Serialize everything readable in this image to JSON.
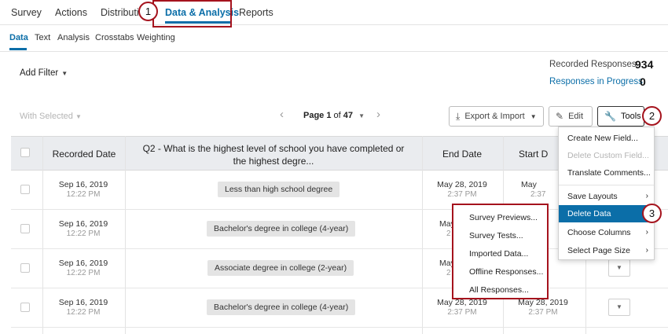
{
  "top_nav": {
    "tabs": [
      {
        "label": "Survey"
      },
      {
        "label": "Actions"
      },
      {
        "label": "Distributio"
      },
      {
        "label": "Data & Analysis"
      },
      {
        "label": "Reports"
      }
    ],
    "active": "Data & Analysis"
  },
  "sub_nav": {
    "tabs": [
      {
        "label": "Data"
      },
      {
        "label": "Text"
      },
      {
        "label": "Analysis"
      },
      {
        "label": "Crosstabs"
      },
      {
        "label": "Weighting"
      }
    ],
    "active": "Data"
  },
  "filter": {
    "label": "Add Filter"
  },
  "stats": {
    "recorded_label": "Recorded Responses",
    "recorded_value": "934",
    "in_progress_label": "Responses in Progress",
    "in_progress_value": "0"
  },
  "toolbar": {
    "with_selected": "With Selected",
    "page_label": "Page",
    "page_current": "1",
    "page_of": "of",
    "page_total": "47",
    "export_label": "Export & Import",
    "edit_label": "Edit",
    "tools_label": "Tools"
  },
  "table": {
    "headers": {
      "recorded_date": "Recorded Date",
      "q2": "Q2 - What is the highest level of school you have completed or the highest degre...",
      "end_date": "End Date",
      "start_date": "Start D"
    },
    "rows": [
      {
        "recorded_date": "Sep 16, 2019",
        "recorded_time": "12:22 PM",
        "answer": "Less than high school degree",
        "end_date": "May 28, 2019",
        "end_time": "2:37 PM",
        "start_date": "May",
        "start_time": "2:37"
      },
      {
        "recorded_date": "Sep 16, 2019",
        "recorded_time": "12:22 PM",
        "answer": "Bachelor's degree in college (4-year)",
        "end_date": "May",
        "end_time": "2",
        "start_date": "",
        "start_time": ""
      },
      {
        "recorded_date": "Sep 16, 2019",
        "recorded_time": "12:22 PM",
        "answer": "Associate degree in college (2-year)",
        "end_date": "May",
        "end_time": "2",
        "start_date": "",
        "start_time": ""
      },
      {
        "recorded_date": "Sep 16, 2019",
        "recorded_time": "12:22 PM",
        "answer": "Bachelor's degree in college (4-year)",
        "end_date": "May 28, 2019",
        "end_time": "2:37 PM",
        "start_date": "May 28, 2019",
        "start_time": "2:37 PM"
      }
    ]
  },
  "tools_menu": {
    "items": [
      {
        "label": "Create New Field..."
      },
      {
        "label": "Delete Custom Field..."
      },
      {
        "label": "Translate Comments..."
      },
      {
        "label": "Save Layouts"
      },
      {
        "label": "Delete Data"
      },
      {
        "label": "Choose Columns"
      },
      {
        "label": "Select Page Size"
      }
    ]
  },
  "delete_submenu": {
    "items": [
      {
        "label": "Survey Previews..."
      },
      {
        "label": "Survey Tests..."
      },
      {
        "label": "Imported Data..."
      },
      {
        "label": "Offline Responses..."
      },
      {
        "label": "All Responses..."
      }
    ]
  },
  "callouts": [
    "1",
    "2",
    "3"
  ],
  "colors": {
    "accent": "#0b6ea8",
    "callout": "#a5131d",
    "header_bg": "#eaecef"
  }
}
